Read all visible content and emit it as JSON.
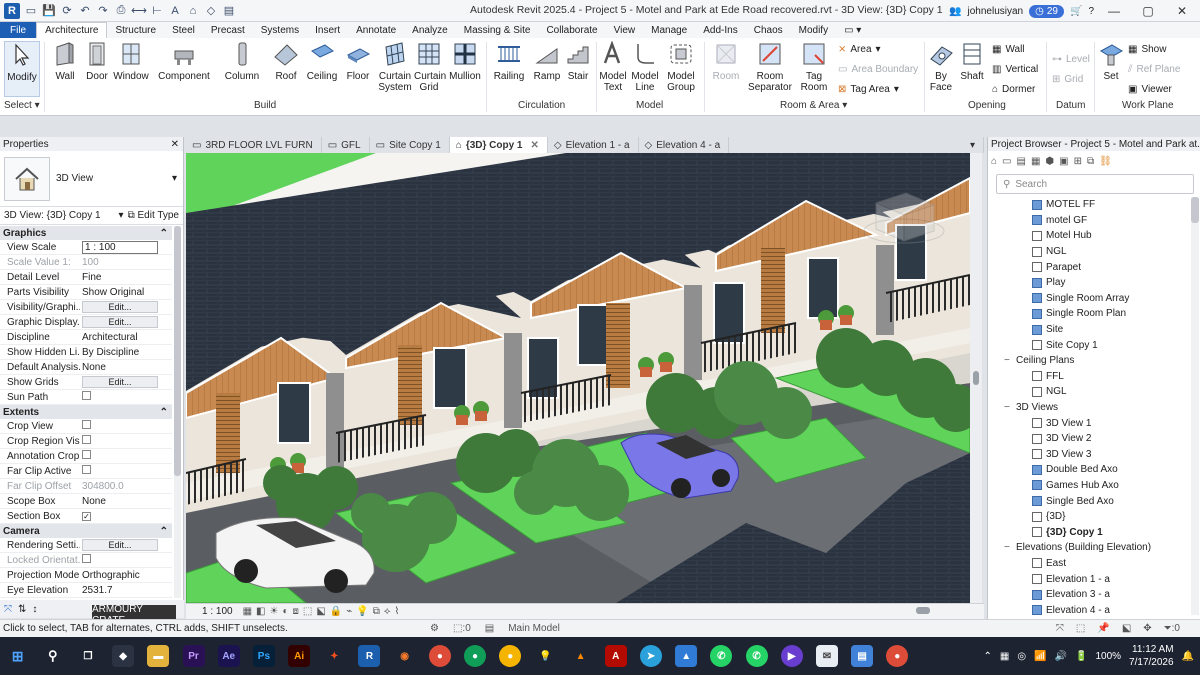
{
  "titlebar": {
    "title": "Autodesk Revit 2025.4 - Project 5 - Motel and Park at Ede Road recovered.rvt - 3D View: {3D} Copy 1",
    "username": "johnelusiyan",
    "notif_count": "29"
  },
  "menu_tabs": [
    "File",
    "Architecture",
    "Structure",
    "Steel",
    "Precast",
    "Systems",
    "Insert",
    "Annotate",
    "Analyze",
    "Massing & Site",
    "Collaborate",
    "View",
    "Manage",
    "Add-Ins",
    "Chaos",
    "Modify"
  ],
  "ribbon": {
    "select_label": "Select",
    "panels": [
      "Build",
      "Circulation",
      "Model",
      "Room & Area",
      "Opening",
      "Datum",
      "Work Plane"
    ],
    "tools": {
      "modify": "Modify",
      "wall": "Wall",
      "door": "Door",
      "window": "Window",
      "component": "Component",
      "column": "Column",
      "roof": "Roof",
      "ceiling": "Ceiling",
      "floor": "Floor",
      "curtain_system": "Curtain System",
      "curtain_grid": "Curtain Grid",
      "mullion": "Mullion",
      "railing": "Railing",
      "ramp": "Ramp",
      "stair": "Stair",
      "model_text": "Model Text",
      "model_line": "Model Line",
      "model_group": "Model Group",
      "room": "Room",
      "room_separator": "Room Separator",
      "tag_room": "Tag Room",
      "area": "Area",
      "area_boundary": "Area  Boundary",
      "tag_area": "Tag  Area",
      "by_face": "By Face",
      "shaft": "Shaft",
      "wall_small": "Wall",
      "vertical": "Vertical",
      "dormer": "Dormer",
      "level": "Level",
      "grid": "Grid",
      "set": "Set",
      "show": "Show",
      "ref_plane": "Ref  Plane",
      "viewer": "Viewer"
    }
  },
  "properties": {
    "header": "Properties",
    "type_name": "3D View",
    "instance": "3D View: {3D} Copy 1",
    "edit_type": "Edit Type",
    "sections": {
      "graphics": "Graphics",
      "extents": "Extents",
      "camera": "Camera"
    },
    "graphics_rows": [
      {
        "k": "View Scale",
        "v": "1 : 100"
      },
      {
        "k": "Scale Value    1:",
        "v": "100"
      },
      {
        "k": "Detail Level",
        "v": "Fine"
      },
      {
        "k": "Parts Visibility",
        "v": "Show Original"
      },
      {
        "k": "Visibility/Graphi...",
        "v": "Edit..."
      },
      {
        "k": "Graphic Display...",
        "v": "Edit..."
      },
      {
        "k": "Discipline",
        "v": "Architectural"
      },
      {
        "k": "Show Hidden Li...",
        "v": "By Discipline"
      },
      {
        "k": "Default Analysis...",
        "v": "None"
      },
      {
        "k": "Show Grids",
        "v": "Edit..."
      },
      {
        "k": "Sun Path",
        "v": ""
      }
    ],
    "extents_rows": [
      {
        "k": "Crop View",
        "v": ""
      },
      {
        "k": "Crop Region Vis...",
        "v": ""
      },
      {
        "k": "Annotation Crop",
        "v": ""
      },
      {
        "k": "Far Clip Active",
        "v": ""
      },
      {
        "k": "Far Clip Offset",
        "v": "304800.0"
      },
      {
        "k": "Scope Box",
        "v": "None"
      },
      {
        "k": "Section Box",
        "v": ""
      }
    ],
    "camera_rows": [
      {
        "k": "Rendering Setti...",
        "v": "Edit..."
      },
      {
        "k": "Locked Orientat...",
        "v": ""
      },
      {
        "k": "Projection Mode",
        "v": "Orthographic"
      },
      {
        "k": "Eye Elevation",
        "v": "2531.7"
      }
    ],
    "tooltip": "ARMOURY CRATE"
  },
  "view_tabs": [
    "3RD FLOOR LVL FURN",
    "GFL",
    "Site Copy 1",
    "{3D} Copy 1",
    "Elevation 1 - a",
    "Elevation 4 - a"
  ],
  "view_bar": {
    "scale": "1 : 100"
  },
  "project_browser": {
    "header": "Project Browser - Project 5 - Motel and Park at...",
    "search_placeholder": "Search",
    "items": [
      {
        "t": "leaf",
        "label": "MOTEL FF",
        "blue": true
      },
      {
        "t": "leaf",
        "label": "motel GF",
        "blue": true
      },
      {
        "t": "leaf",
        "label": "Motel Hub",
        "blue": false
      },
      {
        "t": "leaf",
        "label": "NGL",
        "blue": false
      },
      {
        "t": "leaf",
        "label": "Parapet",
        "blue": false
      },
      {
        "t": "leaf",
        "label": "Play",
        "blue": true
      },
      {
        "t": "leaf",
        "label": "Single Room Array",
        "blue": true
      },
      {
        "t": "leaf",
        "label": "Single Room Plan",
        "blue": true
      },
      {
        "t": "leaf",
        "label": "Site",
        "blue": true
      },
      {
        "t": "leaf",
        "label": "Site Copy 1",
        "blue": false
      },
      {
        "t": "group",
        "label": "Ceiling Plans"
      },
      {
        "t": "leaf",
        "label": "FFL",
        "blue": false
      },
      {
        "t": "leaf",
        "label": "NGL",
        "blue": false
      },
      {
        "t": "group",
        "label": "3D Views"
      },
      {
        "t": "leaf",
        "label": "3D View 1",
        "blue": false
      },
      {
        "t": "leaf",
        "label": "3D View 2",
        "blue": false
      },
      {
        "t": "leaf",
        "label": "3D View 3",
        "blue": false
      },
      {
        "t": "leaf",
        "label": "Double Bed Axo",
        "blue": true
      },
      {
        "t": "leaf",
        "label": "Games Hub Axo",
        "blue": true
      },
      {
        "t": "leaf",
        "label": "Single Bed Axo",
        "blue": true
      },
      {
        "t": "leaf",
        "label": "{3D}",
        "blue": false
      },
      {
        "t": "leaf",
        "label": "{3D} Copy 1",
        "blue": false,
        "bold": true
      },
      {
        "t": "group",
        "label": "Elevations (Building Elevation)"
      },
      {
        "t": "leaf",
        "label": "East",
        "blue": false
      },
      {
        "t": "leaf",
        "label": "Elevation 1 - a",
        "blue": false
      },
      {
        "t": "leaf",
        "label": "Elevation 3 - a",
        "blue": true
      },
      {
        "t": "leaf",
        "label": "Elevation 4 - a",
        "blue": true
      }
    ]
  },
  "status": {
    "message": "Click to select, TAB for alternates, CTRL adds, SHIFT unselects.",
    "count_left": ":0",
    "model": "Main Model",
    "count_right": ":0"
  },
  "taskbar": {
    "time": "11:12 AM",
    "date": "7/17/2026",
    "battery": "100%",
    "apps": [
      "Pr",
      "Ae",
      "Ps",
      "Ai"
    ]
  },
  "colors": {
    "file_tab": "#1d5fb4",
    "roof": "#2b3340",
    "gable": "#c98a52",
    "lawn": "#5fd35a",
    "car_blue": "#7a78e8",
    "taskbar": "#1d2330"
  }
}
